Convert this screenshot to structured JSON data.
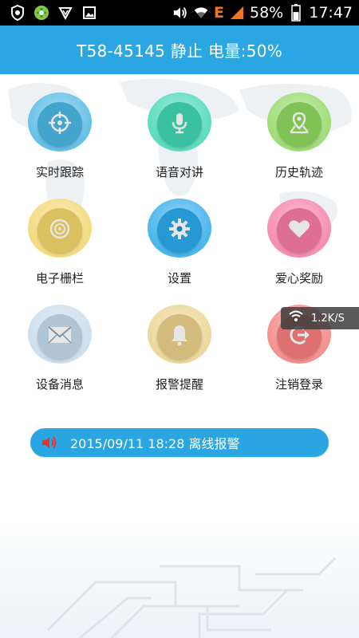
{
  "status_bar": {
    "battery_percent": "58%",
    "time": "17:47",
    "network_type": "E",
    "battery_level": 0.58,
    "icons": [
      "shield-icon",
      "app-icon",
      "vpn-icon",
      "gallery-icon",
      "volume-icon",
      "wifi-icon",
      "signal-icon",
      "battery-icon"
    ]
  },
  "header": {
    "title": "T58-45145 静止 电量:50%"
  },
  "menu": {
    "items": [
      {
        "label": "实时跟踪",
        "icon": "crosshair-icon",
        "color": "#4ab6e3"
      },
      {
        "label": "语音对讲",
        "icon": "microphone-icon",
        "color": "#3fd6b4"
      },
      {
        "label": "历史轨迹",
        "icon": "map-pin-icon",
        "color": "#8fd760"
      },
      {
        "label": "电子栅栏",
        "icon": "disc-icon",
        "color": "#f2d56a"
      },
      {
        "label": "设置",
        "icon": "gear-icon",
        "color": "#2aa9ea"
      },
      {
        "label": "爱心奖励",
        "icon": "heart-icon",
        "color": "#f57aa5"
      },
      {
        "label": "设备消息",
        "icon": "envelope-icon",
        "color": "#c5daea"
      },
      {
        "label": "报警提醒",
        "icon": "bell-icon",
        "color": "#ead08a"
      },
      {
        "label": "注销登录",
        "icon": "logout-icon",
        "color": "#f57c7c"
      }
    ]
  },
  "toast": {
    "speed": "1.2K/S",
    "icon": "wifi-icon"
  },
  "alarm": {
    "text": "2015/09/11 18:28 离线报警",
    "icon": "speaker-icon",
    "icon_color": "#e8322c"
  }
}
